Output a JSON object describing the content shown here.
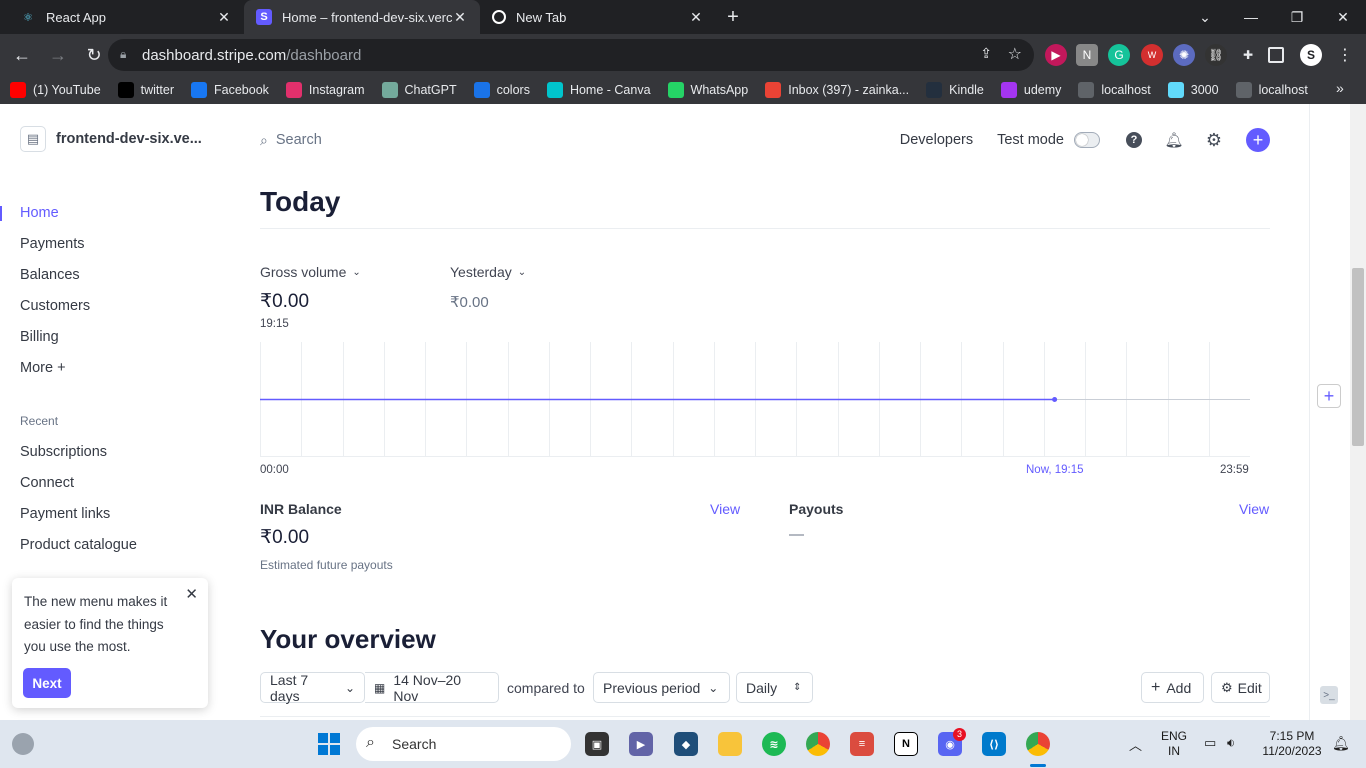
{
  "browser": {
    "tabs": [
      {
        "title": "React App",
        "icon": "react-icon",
        "color": "#61dafb"
      },
      {
        "title": "Home – frontend-dev-six.vercel.app",
        "icon": "stripe-icon",
        "color": "#635bff"
      },
      {
        "title": "New Tab",
        "icon": "chrome-icon",
        "color": "#ffffff"
      }
    ],
    "url_host": "dashboard.stripe.com",
    "url_path": "/dashboard",
    "bookmarks": [
      {
        "label": "(1) YouTube",
        "icon": "youtube-icon",
        "color": "#ff0000"
      },
      {
        "label": "twitter",
        "icon": "x-icon",
        "color": "#000000"
      },
      {
        "label": "Facebook",
        "icon": "facebook-icon",
        "color": "#1877f2"
      },
      {
        "label": "Instagram",
        "icon": "instagram-icon",
        "color": "#e1306c"
      },
      {
        "label": "ChatGPT",
        "icon": "chatgpt-icon",
        "color": "#74aa9c"
      },
      {
        "label": "colors",
        "icon": "colors-icon",
        "color": "#1a73e8"
      },
      {
        "label": "Home - Canva",
        "icon": "canva-icon",
        "color": "#00c4cc"
      },
      {
        "label": "WhatsApp",
        "icon": "whatsapp-icon",
        "color": "#25d366"
      },
      {
        "label": "Inbox (397) - zainka...",
        "icon": "gmail-icon",
        "color": "#ea4335"
      },
      {
        "label": "Kindle",
        "icon": "kindle-icon",
        "color": "#232f3e"
      },
      {
        "label": "udemy",
        "icon": "udemy-icon",
        "color": "#a435f0"
      },
      {
        "label": "localhost",
        "icon": "globe-icon",
        "color": "#5f6368"
      },
      {
        "label": "3000",
        "icon": "react-icon",
        "color": "#61dafb"
      },
      {
        "label": "localhost",
        "icon": "globe-icon",
        "color": "#5f6368"
      }
    ]
  },
  "dashboard": {
    "account_name": "frontend-dev-six.ve...",
    "search_placeholder": "Search",
    "developers": "Developers",
    "test_mode": "Test mode",
    "nav": [
      "Home",
      "Payments",
      "Balances",
      "Customers",
      "Billing",
      "More +"
    ],
    "recent_heading": "Recent",
    "recent": [
      "Subscriptions",
      "Connect",
      "Payment links",
      "Product catalogue"
    ],
    "popup": {
      "text": "The new menu makes it easier to find the things you use the most.",
      "next": "Next"
    },
    "today_title": "Today",
    "gross_volume_label": "Gross volume",
    "gross_volume_value": "₹0.00",
    "gross_volume_time": "19:15",
    "yesterday_label": "Yesterday",
    "yesterday_value": "₹0.00",
    "axis_start": "00:00",
    "axis_now": "Now, 19:15",
    "axis_end": "23:59",
    "balance_title": "INR Balance",
    "balance_view": "View",
    "balance_value": "₹0.00",
    "balance_sub": "Estimated future payouts",
    "payouts_title": "Payouts",
    "payouts_view": "View",
    "payouts_value": "—",
    "overview_title": "Your overview",
    "filter_range": "Last 7 days",
    "filter_dates": "14 Nov–20 Nov",
    "compared_to": "compared to",
    "filter_compare": "Previous period",
    "filter_interval": "Daily",
    "add": "Add",
    "edit": "Edit",
    "accent": "#635bff"
  },
  "chart_data": {
    "type": "line",
    "x": [
      "00:00",
      "Now, 19:15"
    ],
    "values": [
      0,
      0
    ],
    "xlim": [
      "00:00",
      "23:59"
    ],
    "series_color": "#635bff"
  },
  "taskbar": {
    "search": "Search",
    "lang": "ENG",
    "region": "IN",
    "time": "7:15 PM",
    "date": "11/20/2023",
    "badge": "3"
  }
}
